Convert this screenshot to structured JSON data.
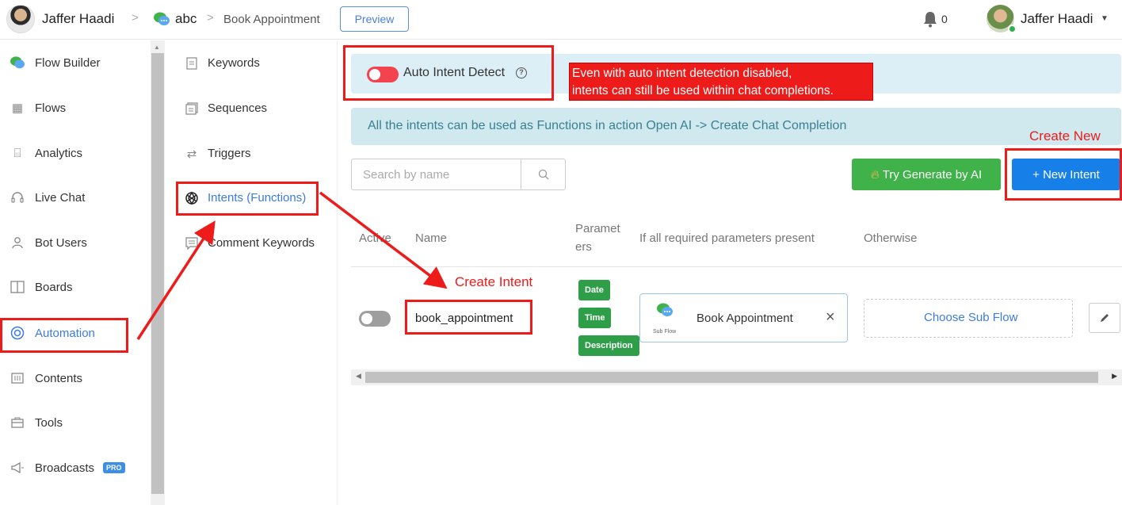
{
  "topbar": {
    "user_name": "Jaffer Haadi",
    "bot_name": "abc",
    "page_name": "Book Appointment",
    "preview_label": "Preview",
    "notification_count": "0",
    "account_name": "Jaffer Haadi",
    "breadcrumb_sep": ">"
  },
  "sidebar": {
    "items": [
      {
        "label": "Flow Builder",
        "icon": "flow-builder-icon"
      },
      {
        "label": "Flows",
        "icon": "grid-icon"
      },
      {
        "label": "Analytics",
        "icon": "analytics-icon"
      },
      {
        "label": "Live Chat",
        "icon": "headset-icon"
      },
      {
        "label": "Bot Users",
        "icon": "user-icon"
      },
      {
        "label": "Boards",
        "icon": "board-icon"
      },
      {
        "label": "Automation",
        "icon": "lifebuoy-icon",
        "active": true
      },
      {
        "label": "Contents",
        "icon": "contents-icon"
      },
      {
        "label": "Tools",
        "icon": "toolbox-icon"
      },
      {
        "label": "Broadcasts",
        "icon": "megaphone-icon",
        "badge": "PRO"
      }
    ]
  },
  "automation_menu": {
    "items": [
      {
        "label": "Keywords",
        "icon": "keywords-icon"
      },
      {
        "label": "Sequences",
        "icon": "sequences-icon"
      },
      {
        "label": "Triggers",
        "icon": "triggers-icon"
      },
      {
        "label": "Intents (Functions)",
        "icon": "openai-icon",
        "active": true
      },
      {
        "label": "Comment Keywords",
        "icon": "comment-icon"
      }
    ]
  },
  "main": {
    "auto_intent_label": "Auto Intent Detect",
    "auto_intent_enabled": false,
    "info_text": "All the intents can be used as Functions in action Open AI -> Create Chat Completion",
    "search_placeholder": "Search by name",
    "try_generate_label": "Try Generate by AI",
    "new_intent_label": "+ New Intent",
    "table": {
      "headers": {
        "active": "Active",
        "name": "Name",
        "parameters_line1": "Paramet",
        "parameters_line2": "ers",
        "if_present": "If all required parameters present",
        "otherwise": "Otherwise"
      },
      "rows": [
        {
          "active": false,
          "name": "book_appointment",
          "parameters": [
            "Date",
            "Time",
            "Description"
          ],
          "sub_flow_caption": "Sub Flow",
          "sub_flow_name": "Book Appointment",
          "otherwise": "Choose Sub Flow"
        }
      ]
    }
  },
  "annotations": {
    "note_line1": "Even with auto intent detection disabled,",
    "note_line2": "intents can still be used within chat completions.",
    "create_new": "Create New",
    "create_intent": "Create Intent"
  },
  "colors": {
    "accent": "#3d7be0",
    "annotation_red": "#ee1b1b",
    "try_button": "#3fb24a",
    "new_intent_button": "#1680e8"
  }
}
